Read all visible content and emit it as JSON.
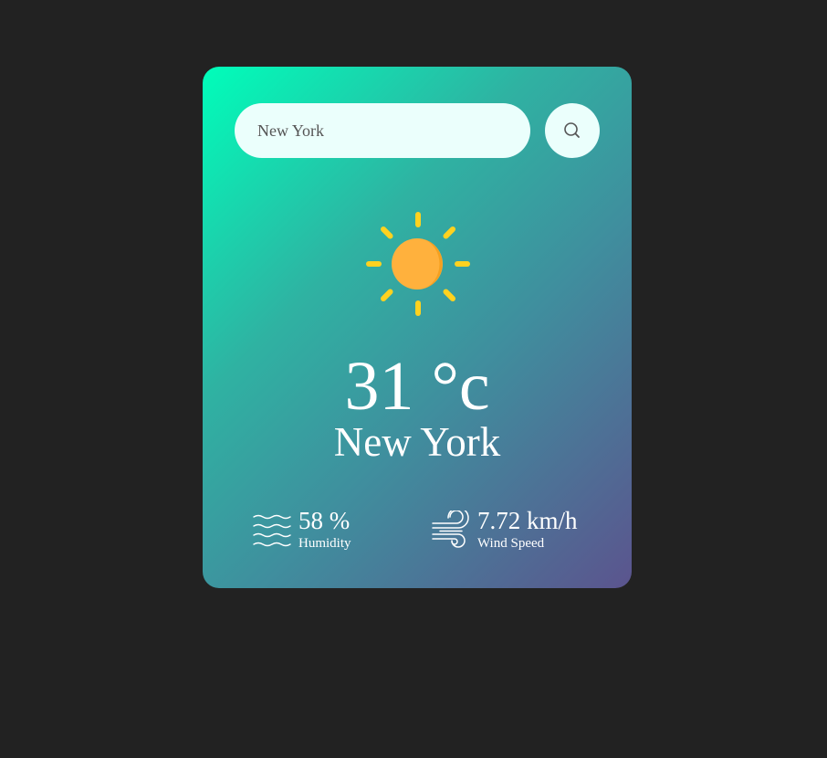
{
  "search": {
    "value": "New York",
    "button_icon": "search-icon"
  },
  "weather": {
    "icon": "sun-icon",
    "temperature": "31 °c",
    "city": "New York"
  },
  "details": {
    "humidity": {
      "icon": "humidity-waves-icon",
      "value": "58 %",
      "label": "Humidity"
    },
    "wind": {
      "icon": "wind-icon",
      "value": "7.72 km/h",
      "label": "Wind Speed"
    }
  },
  "colors": {
    "background": "#222222",
    "card_gradient_start": "#00feba",
    "card_gradient_end": "#5b548e",
    "input_background": "#ebfffc",
    "sun_body": "#ffb13d",
    "sun_rays": "#ffd21f"
  }
}
